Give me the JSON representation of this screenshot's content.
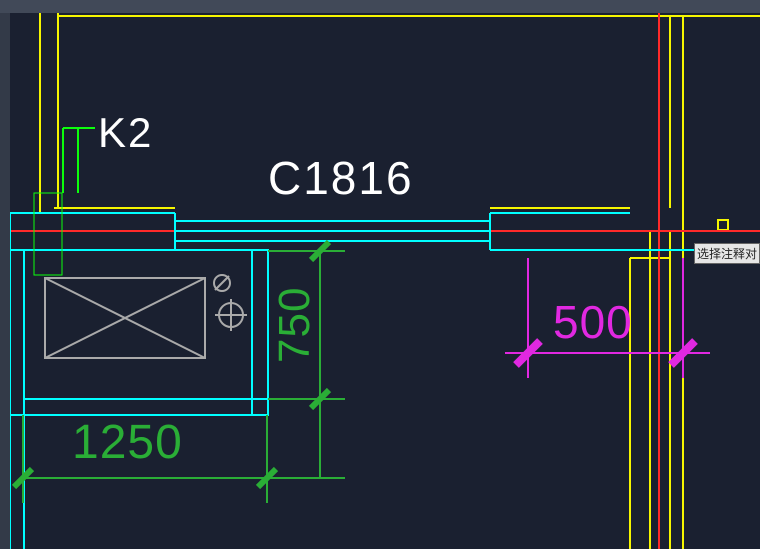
{
  "labels": {
    "k2": "K2",
    "c1816": "C1816"
  },
  "dimensions": {
    "d1250": "1250",
    "d750": "750",
    "d500": "500"
  },
  "tooltip": "选择注释对",
  "colors": {
    "bg": "#1a2030",
    "cyan": "#00ffff",
    "yellow": "#f6f600",
    "red": "#ff2a2a",
    "green": "#2aae36",
    "magenta": "#e128e1",
    "gray": "#888888",
    "white": "#ffffff"
  }
}
